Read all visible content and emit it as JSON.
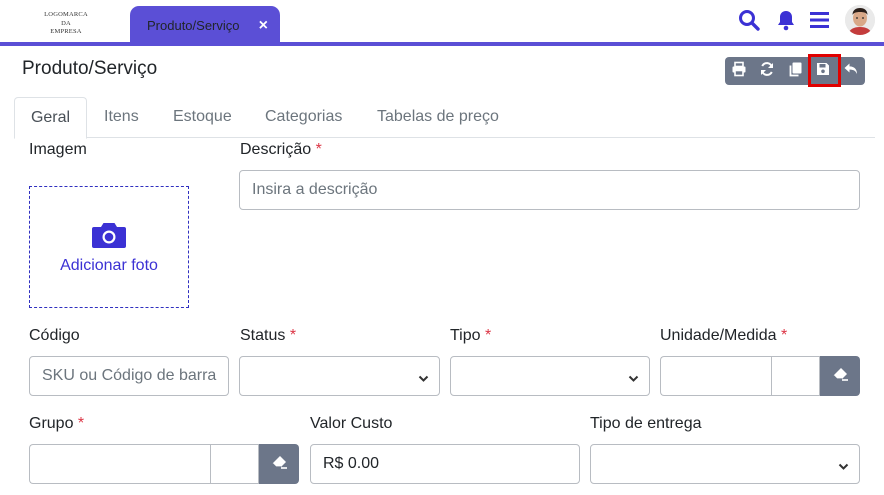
{
  "header": {
    "logo_lines": [
      "LOGOMARCA",
      "DA",
      "EMPRESA"
    ],
    "tab_label": "Produto/Serviço",
    "tab_close": "×",
    "icons": [
      "search-icon",
      "bell-icon",
      "menu-icon",
      "avatar"
    ],
    "accent_color": "#5b4fd6"
  },
  "page": {
    "title": "Produto/Serviço"
  },
  "toolbar": {
    "buttons": [
      "print-icon",
      "refresh-icon",
      "copy-icon",
      "save-icon",
      "undo-icon"
    ],
    "highlighted": "save-icon",
    "highlight_color": "#e00000"
  },
  "tabs": [
    "Geral",
    "Itens",
    "Estoque",
    "Categorias",
    "Tabelas de preço"
  ],
  "form": {
    "image_label": "Imagem",
    "add_photo": "Adicionar foto",
    "description_label": "Descrição",
    "description_placeholder": "Insira a descrição",
    "code_label": "Código",
    "code_placeholder": "SKU ou Código de barra",
    "status_label": "Status",
    "type_label": "Tipo",
    "unit_label": "Unidade/Medida",
    "group_label": "Grupo",
    "cost_label": "Valor Custo",
    "cost_value": "R$ 0.00",
    "delivery_label": "Tipo de entrega",
    "required_mark": "*"
  }
}
